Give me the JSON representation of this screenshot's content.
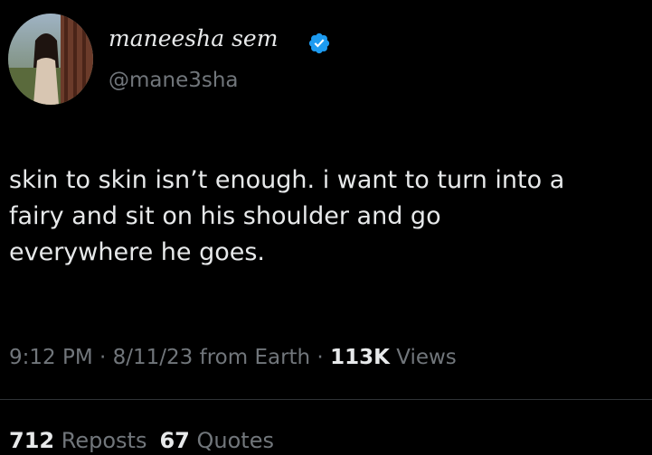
{
  "author": {
    "display_name": "maneesha sem",
    "handle": "@mane3sha",
    "verified": true,
    "avatar_icon": "profile-photo"
  },
  "tweet": {
    "lines": [
      "skin to skin isn’t enough. i want to turn into a",
      "fairy and sit on his shoulder and go",
      "everywhere he goes."
    ]
  },
  "meta": {
    "time": "9:12 PM",
    "sep1": " · ",
    "date": "8/11/23",
    "source": " from Earth",
    "sep2": " · ",
    "views_count": "113K",
    "views_label": " Views"
  },
  "stats": {
    "reposts_count": "712",
    "reposts_label": "Reposts",
    "quotes_count": "67",
    "quotes_label": "Quotes"
  },
  "colors": {
    "background": "#000000",
    "primary_text": "#e7e9ea",
    "secondary_text": "#71767b",
    "verified_badge": "#1d9bf0",
    "divider": "#2f3336"
  }
}
